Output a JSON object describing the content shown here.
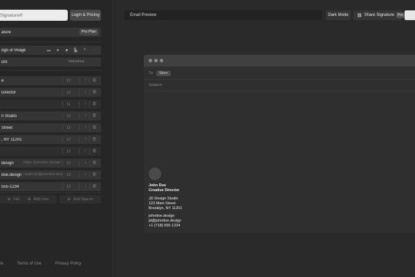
{
  "search": {
    "value": "Signature®"
  },
  "top_actions": {
    "login_pricing": "Login & Pricing"
  },
  "settings": {
    "signature_row": {
      "label": "ature",
      "badge": "Pro Plan"
    },
    "logo_row": {
      "label": "ogo or Image"
    },
    "font_row": {
      "label": "ont",
      "value": "Helvetica"
    }
  },
  "fields": [
    {
      "label": "e",
      "size": "12"
    },
    {
      "label": "Director",
      "size": "12"
    },
    {
      "label": "",
      "size": "11"
    },
    {
      "label": "n Studio",
      "size": "12"
    },
    {
      "label": "Street",
      "size": "12"
    },
    {
      "label": ", NY 11201",
      "size": "12"
    },
    {
      "label": "",
      "size": "12"
    },
    {
      "label": "design",
      "placeholder": "https://johndoe.design",
      "size": "12"
    },
    {
      "label": "doe.design",
      "placeholder": "mailto:jd@johndoe.desi",
      "size": "12"
    },
    {
      "label": "555-1234",
      "size": "12"
    }
  ],
  "add_buttons": {
    "field": "Field",
    "line": "Add Line",
    "spacer": "Add Spacer"
  },
  "footer": {
    "a": "ure",
    "terms": "Terms of Use",
    "privacy": "Privacy Policy"
  },
  "preview": {
    "title": "Email Preview",
    "dark_mode": "Dark Mode",
    "share": "Share Signature",
    "pro": "Pro",
    "to_label": "To:",
    "to_value": "Mom",
    "subject_label": "Subject:"
  },
  "signature": {
    "name": "John Doe",
    "title": "Creative Director",
    "company": "JD Design Studio",
    "street": "123 Main Street",
    "city": "Brooklyn, NY 11201",
    "website": "johndoe.design",
    "email": "jd@johndoe.design",
    "phone": "+1 (718) 555-1234"
  }
}
